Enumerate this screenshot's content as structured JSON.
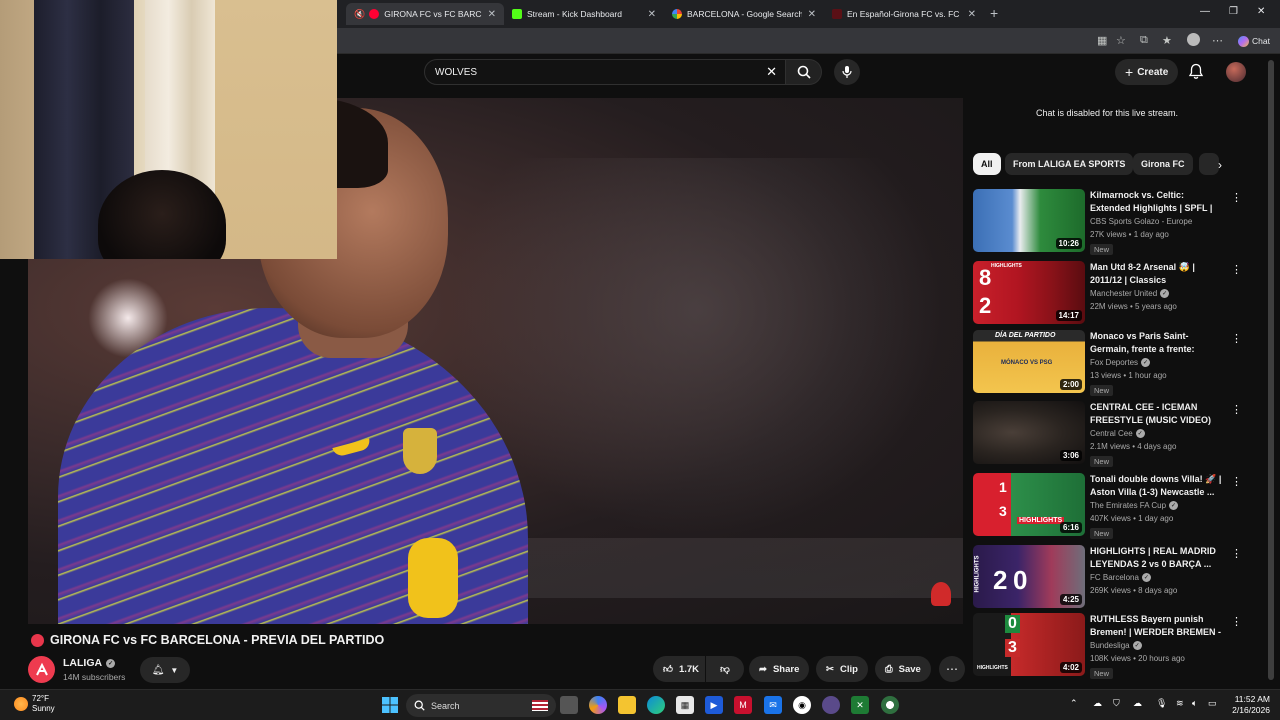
{
  "browser": {
    "tabs": [
      {
        "title": "GIRONA FC vs FC BARCEL",
        "active": true,
        "favicon": "youtube-red"
      },
      {
        "title": "Stream - Kick Dashboard",
        "active": false,
        "favicon": "kick-green"
      },
      {
        "title": "BARCELONA - Google Search",
        "active": false,
        "favicon": "google"
      },
      {
        "title": "En Español-Girona FC vs. FC Barce",
        "active": false,
        "favicon": "red-square"
      }
    ],
    "copilot_label": "Chat"
  },
  "youtube": {
    "search_value": "WOLVES",
    "create_label": "Create",
    "video": {
      "title": "GIRONA FC vs FC BARCELONA - PREVIA DEL PARTIDO",
      "channel": "LALIGA",
      "subscribers": "14M subscribers",
      "likes": "1.7K",
      "share_label": "Share",
      "clip_label": "Clip",
      "save_label": "Save"
    },
    "chat_disabled": "Chat is disabled for this live stream.",
    "chips": [
      "All",
      "From LALIGA EA SPORTS",
      "Girona FC"
    ],
    "recommendations": [
      {
        "title": "Kilmarnock vs. Celtic: Extended Highlights | SPFL | CBS Sports...",
        "channel": "CBS Sports Golazo - Europe",
        "meta": "27K views • 1 day ago",
        "badge": "New",
        "duration": "10:26",
        "verified": false
      },
      {
        "title": "Man Utd 8-2 Arsenal 🤯 | 2011/12 | Classics",
        "channel": "Manchester United",
        "meta": "22M views • 5 years ago",
        "badge": "",
        "duration": "14:17",
        "verified": true
      },
      {
        "title": "Monaco vs Paris Saint-Germain, frente a frente: Champions ...",
        "channel": "Fox Deportes",
        "meta": "13 views • 1 hour ago",
        "badge": "New",
        "duration": "2:00",
        "verified": true
      },
      {
        "title": "CENTRAL CEE - ICEMAN FREESTYLE (MUSIC VIDEO)",
        "channel": "Central Cee",
        "meta": "2.1M views • 4 days ago",
        "badge": "New",
        "duration": "3:06",
        "verified": true
      },
      {
        "title": "Tonali double downs Villa! 🚀 | Aston Villa (1-3) Newcastle ...",
        "channel": "The Emirates FA Cup",
        "meta": "407K views • 1 day ago",
        "badge": "New",
        "duration": "6:16",
        "verified": true
      },
      {
        "title": "HIGHLIGHTS | REAL MADRID LEYENDAS 2 vs 0 BARÇA ...",
        "channel": "FC Barcelona",
        "meta": "269K views • 8 days ago",
        "badge": "",
        "duration": "4:25",
        "verified": true
      },
      {
        "title": "RUTHLESS Bayern punish Bremen! | WERDER BREMEN - ...",
        "channel": "Bundesliga",
        "meta": "108K views • 20 hours ago",
        "badge": "New",
        "duration": "4:02",
        "verified": true
      }
    ],
    "thumb_texts": {
      "t2": [
        "8",
        "2",
        "HIGHLIGHTS"
      ],
      "t3": [
        "DÍA DEL PARTIDO",
        "MÓNACO VS PSG"
      ],
      "t5": [
        "1",
        "3",
        "HIGHLIGHTS"
      ],
      "t6": [
        "2",
        "0",
        "HIGHLIGHTS"
      ],
      "t7": [
        "0",
        "3",
        "HIGHLIGHTS"
      ]
    }
  },
  "taskbar": {
    "temp": "72°F",
    "condition": "Sunny",
    "search_label": "Search",
    "time": "11:52 AM",
    "date": "2/16/2026"
  }
}
